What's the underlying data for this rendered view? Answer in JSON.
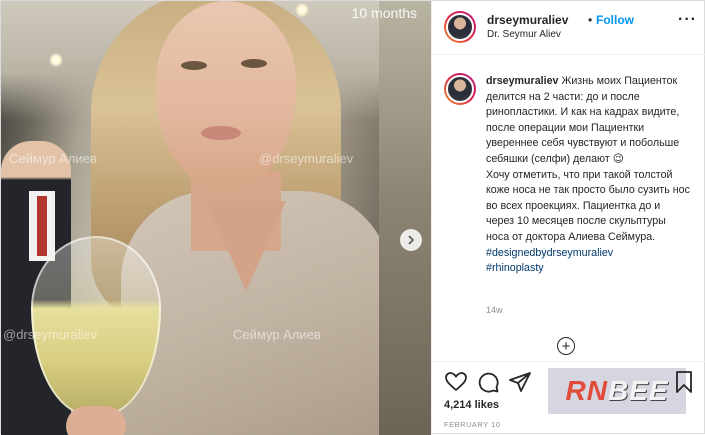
{
  "media": {
    "months_label": "10 months",
    "watermarks": [
      "Сеймур Алиев",
      "@drseymuraliev",
      "@drseymuraliev",
      "Сеймур Алиев"
    ]
  },
  "header": {
    "username": "drseymuraliev",
    "separator": "•",
    "follow_label": "Follow",
    "subtitle": "Dr. Seymur Aliev",
    "more_label": "···"
  },
  "caption": {
    "username": "drseymuraliev",
    "text_1": "Жизнь моих Пациенток делится на 2 части: до и после ринопластики. И как на кадрах видите, после операции мои Пациентки увереннее себя чувствуют и побольше себяшки (селфи) делают 😉",
    "text_2": "Хочу отметить, что при такой толстой коже носа не так просто было сузить нос во всех проекциях. Пациентка до и через 10 месяцев после скульптуры носа от доктора Алиева Сеймура.",
    "hashtags": [
      "#designedbydrseymuraliev",
      "#rhinoplasty"
    ],
    "time": "14w"
  },
  "load_more_label": "+",
  "actions": {
    "likes": "4,214 likes",
    "date": "FEBRUARY 10",
    "icons": [
      "heart-icon",
      "comment-icon",
      "share-icon",
      "bookmark-icon"
    ]
  },
  "overlay_logo": {
    "rn": "RN",
    "bee": "BEE"
  },
  "colors": {
    "follow": "#0095f6",
    "hashtag": "#00376b",
    "muted": "#8e8e8e"
  }
}
